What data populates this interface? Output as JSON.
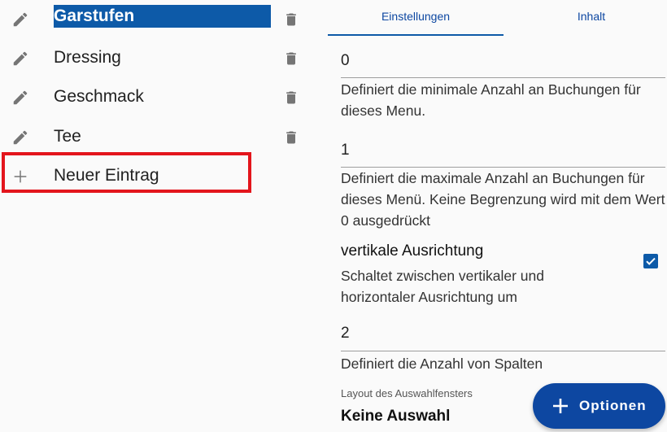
{
  "list": {
    "items": [
      {
        "label": "Garstufen",
        "selected": true
      },
      {
        "label": "Dressing",
        "selected": false
      },
      {
        "label": "Geschmack",
        "selected": false
      },
      {
        "label": "Tee",
        "selected": false
      }
    ],
    "new_entry_label": "Neuer Eintrag"
  },
  "tabs": [
    {
      "label": "Einstellungen",
      "active": true
    },
    {
      "label": "Inhalt",
      "active": false
    }
  ],
  "settings": {
    "min_bookings": {
      "value": "0",
      "description": "Definiert die minimale Anzahl an Buchungen für dieses Menu."
    },
    "max_bookings": {
      "value": "1",
      "description": "Definiert die maximale Anzahl an Buchungen für dieses Menü. Keine Begrenzung wird mit dem Wert 0 ausgedrückt"
    },
    "vertical": {
      "title": "vertikale Ausrichtung",
      "description": "Schaltet zwischen vertikaler und horizontaler Ausrichtung um",
      "checked": true
    },
    "columns": {
      "value": "2",
      "description": "Definiert die Anzahl von  Spalten"
    },
    "layout": {
      "label": "Layout des Auswahlfensters",
      "value": "Keine Auswahl"
    }
  },
  "fab": {
    "label": "Optionen"
  },
  "colors": {
    "accent": "#0d5aa8",
    "highlight_box": "#e3151c",
    "icon": "#757575"
  }
}
